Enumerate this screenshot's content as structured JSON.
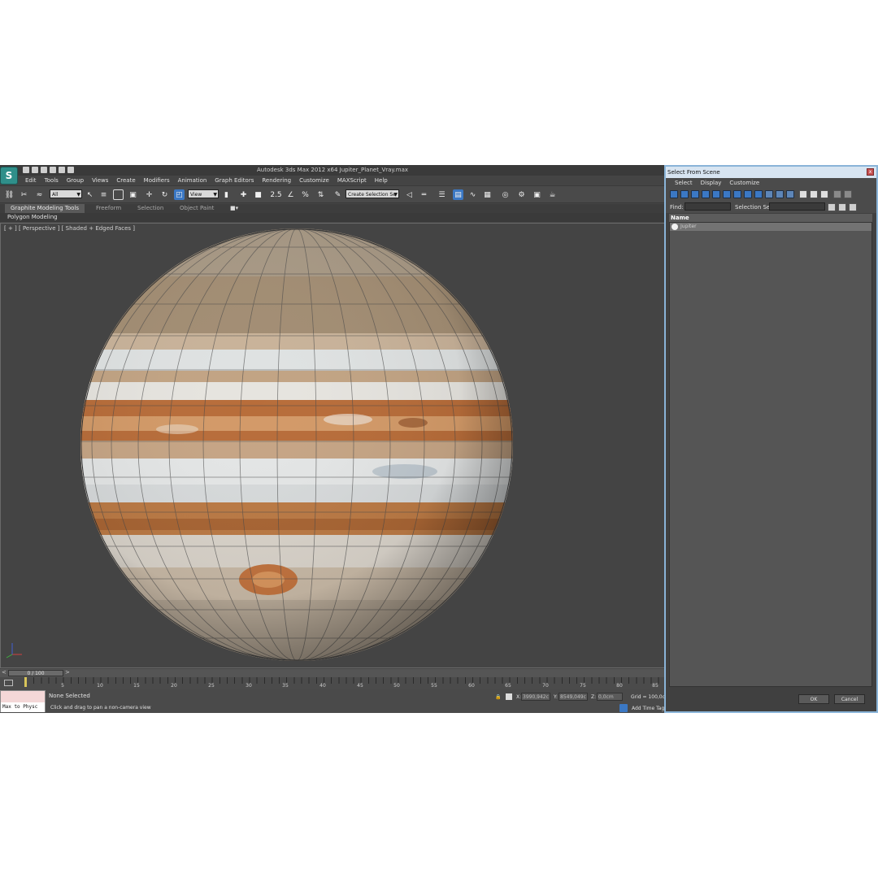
{
  "app": {
    "logo_text": "S",
    "window_title": "Autodesk 3ds Max  2012 x64     Jupiter_Planet_Vray.max"
  },
  "menubar": [
    "Edit",
    "Tools",
    "Group",
    "Views",
    "Create",
    "Modifiers",
    "Animation",
    "Graph Editors",
    "Rendering",
    "Customize",
    "MAXScript",
    "Help"
  ],
  "toolbar": {
    "selection_filter": "All",
    "reference_coord": "View",
    "named_selection_placeholder": "Create Selection Se",
    "icons": [
      "link-icon",
      "unlink-icon",
      "bind-space-warp-icon",
      "select-object-icon",
      "select-by-name-icon",
      "rect-region-icon",
      "window-crossing-icon",
      "move-icon",
      "rotate-icon",
      "scale-icon",
      "pivot-icon",
      "manipulate-icon",
      "snap-icon",
      "angle-snap-icon",
      "percent-snap-icon",
      "spinner-snap-icon",
      "edit-named-sets-icon",
      "mirror-icon",
      "align-icon",
      "layer-manager-icon",
      "graphite-toggle-icon",
      "curve-editor-icon",
      "schematic-view-icon",
      "material-editor-icon",
      "render-setup-icon",
      "rendered-frame-icon",
      "render-icon",
      "teapot-icon"
    ]
  },
  "ribbon": {
    "tabs": [
      "Graphite Modeling Tools",
      "Freeform",
      "Selection",
      "Object Paint"
    ],
    "active_tab": 0,
    "panel_label": "Polygon Modeling"
  },
  "viewport": {
    "label": "[ + ] [ Perspective ] [ Shaded + Edged Faces ]",
    "object": "Jupiter"
  },
  "timeline": {
    "frame_display": "0 / 100",
    "prev": "<",
    "next": ">",
    "ticks": [
      "5",
      "10",
      "15",
      "20",
      "25",
      "30",
      "35",
      "40",
      "45",
      "50",
      "55",
      "60",
      "65",
      "70",
      "75",
      "80",
      "85"
    ]
  },
  "status": {
    "maxscript_listener": "Max to Physc",
    "selection": "None Selected",
    "prompt": "Click and drag to pan a non-camera view",
    "x_label": "X:",
    "x_value": "3990,942c",
    "y_label": "Y:",
    "y_value": "8549,049c",
    "z_label": "Z:",
    "z_value": "0,0cm",
    "grid": "Grid = 100,0c",
    "add_time_tag": "Add Time Tag"
  },
  "dialog": {
    "title": "Select From Scene",
    "close": "x",
    "menu": [
      "Select",
      "Display",
      "Customize"
    ],
    "find_label": "Find:",
    "selection_set_label": "Selection Set:",
    "column_header": "Name",
    "items": [
      "Jupiter"
    ],
    "ok": "OK",
    "cancel": "Cancel"
  },
  "colors": {
    "accent_blue": "#3b78c4",
    "dialog_border": "#8ab4d8",
    "listener_bg": "#f4d7d7"
  }
}
